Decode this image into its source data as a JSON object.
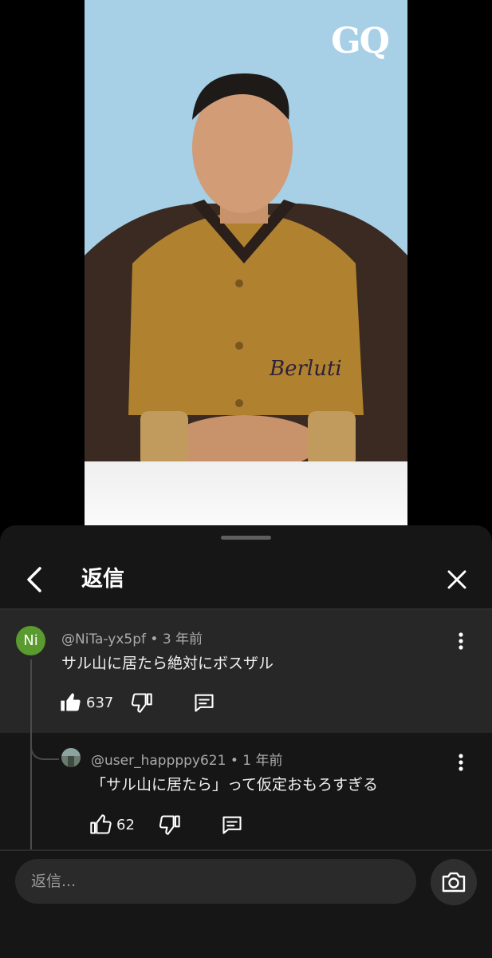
{
  "video": {
    "watermark": "GQ",
    "jacket_text": "Berluti"
  },
  "header": {
    "title": "返信"
  },
  "parent_comment": {
    "author": "@NiTa-yx5pf",
    "time": "3 年前",
    "avatar_text": "Ni",
    "text": "サル山に居たら絶対にボスザル",
    "likes": "637"
  },
  "reply_comment": {
    "author": "@user_happppy621",
    "time": "1 年前",
    "text": "「サル山に居たら」って仮定おもろすぎる",
    "likes": "62"
  },
  "composer": {
    "placeholder": "返信..."
  },
  "colors": {
    "sheet": "#161616",
    "highlight": "#272727",
    "avatar_ni": "#5a9a2f"
  }
}
